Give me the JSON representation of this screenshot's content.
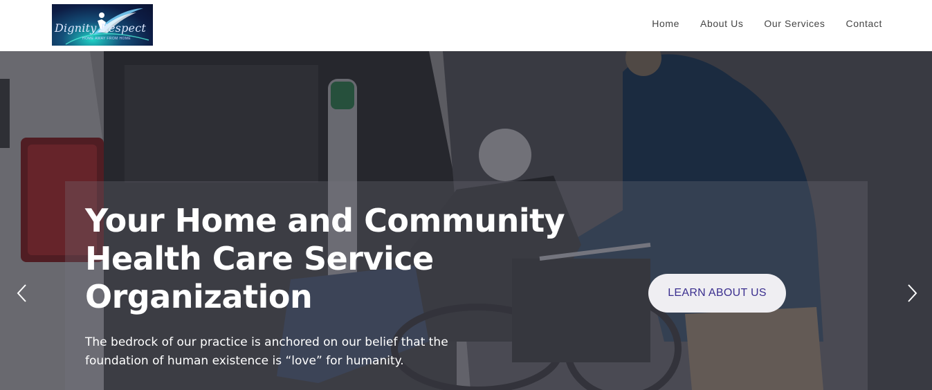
{
  "header": {
    "logo": {
      "title": "Dignity Respect",
      "tagline": "HOME AWAY FROM HOME",
      "icon": "person-swoosh-logo-icon"
    },
    "nav": [
      "Home",
      "About Us",
      "Our Services",
      "Contact"
    ]
  },
  "hero": {
    "headline": "Your Home and Community Health Care Service Organization",
    "subtext": "The bedrock of our practice is anchored on our belief that the foundation of human existence is “love” for humanity.",
    "cta_label": "LEARN ABOUT US",
    "prev_icon": "chevron-left-icon",
    "next_icon": "chevron-right-icon",
    "image": "caregiver-pushing-wheelchair-photo"
  },
  "colors": {
    "cta_text": "#3b2f8f",
    "cta_background": "#efeef2",
    "nav_text": "#444444"
  }
}
